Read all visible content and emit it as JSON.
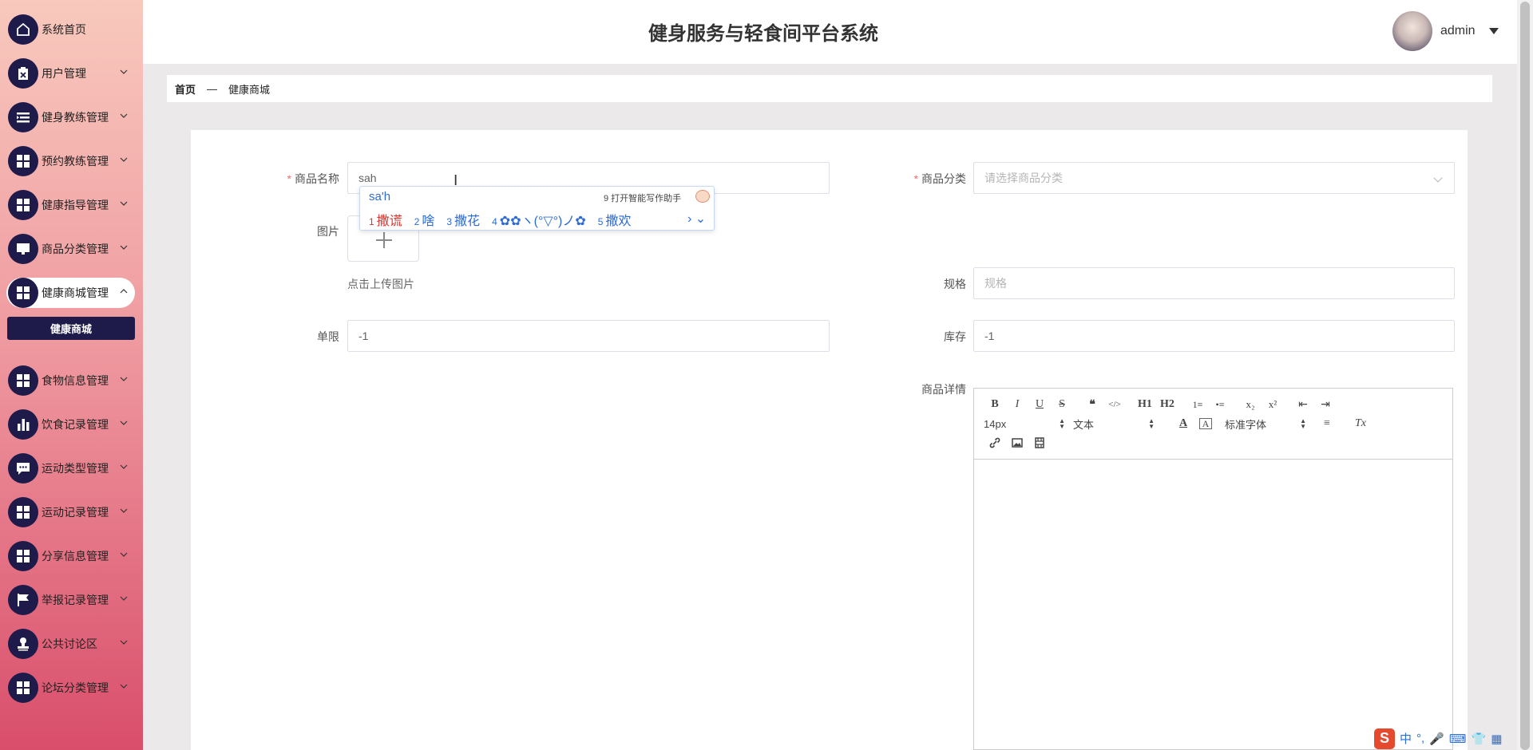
{
  "app": {
    "title": "健身服务与轻食间平台系统"
  },
  "user": {
    "name": "admin"
  },
  "sidebar": {
    "items": [
      {
        "label": "系统首页",
        "icon": "home-icon",
        "has_chevron": false
      },
      {
        "label": "用户管理",
        "icon": "clipboard-icon",
        "has_chevron": true
      },
      {
        "label": "健身教练管理",
        "icon": "list-icon",
        "has_chevron": true
      },
      {
        "label": "预约教练管理",
        "icon": "grid-icon",
        "has_chevron": true
      },
      {
        "label": "健康指导管理",
        "icon": "grid-icon",
        "has_chevron": true
      },
      {
        "label": "商品分类管理",
        "icon": "monitor-icon",
        "has_chevron": true
      },
      {
        "label": "健康商城管理",
        "icon": "grid-icon",
        "has_chevron": true,
        "expanded": true
      },
      {
        "label": "食物信息管理",
        "icon": "grid-icon",
        "has_chevron": true
      },
      {
        "label": "饮食记录管理",
        "icon": "bar-chart-icon",
        "has_chevron": true
      },
      {
        "label": "运动类型管理",
        "icon": "chat-icon",
        "has_chevron": true
      },
      {
        "label": "运动记录管理",
        "icon": "grid-icon",
        "has_chevron": true
      },
      {
        "label": "分享信息管理",
        "icon": "grid-icon",
        "has_chevron": true
      },
      {
        "label": "举报记录管理",
        "icon": "flag-icon",
        "has_chevron": true
      },
      {
        "label": "公共讨论区",
        "icon": "stamp-icon",
        "has_chevron": true
      },
      {
        "label": "论坛分类管理",
        "icon": "grid-icon",
        "has_chevron": true
      }
    ],
    "submenu": {
      "label": "健康商城"
    }
  },
  "breadcrumb": {
    "home": "首页",
    "separator": "—",
    "current": "健康商城"
  },
  "form": {
    "name": {
      "label": "商品名称",
      "value": "sah"
    },
    "category": {
      "label": "商品分类",
      "placeholder": "请选择商品分类"
    },
    "image": {
      "label": "图片",
      "hint": "点击上传图片"
    },
    "spec": {
      "label": "规格",
      "placeholder": "规格"
    },
    "limit": {
      "label": "单限",
      "value": "-1"
    },
    "stock": {
      "label": "库存",
      "value": "-1"
    },
    "detail": {
      "label": "商品详情"
    }
  },
  "ime": {
    "composition": "sa'h",
    "assistant_hint": "9 打开智能写作助手",
    "candidates": [
      {
        "num": "1",
        "text": "撒谎"
      },
      {
        "num": "2",
        "text": "啥"
      },
      {
        "num": "3",
        "text": "撒花"
      },
      {
        "num": "4",
        "text": "✿✿ヽ(°▽°)ノ✿"
      },
      {
        "num": "5",
        "text": "撒欢"
      }
    ],
    "nav": "› ⌄"
  },
  "editor": {
    "font_size": "14px",
    "header": "文本",
    "font_family": "标准字体",
    "buttons_row1": [
      "B",
      "I",
      "U",
      "S",
      "❝",
      "</>",
      "H1",
      "H2",
      "1≡",
      "•≡",
      "x₂",
      "x²",
      "⇤",
      "⇥"
    ],
    "buttons_row2": [
      "A",
      "A",
      "≡",
      "Tx"
    ]
  },
  "tray": {
    "lang": "中",
    "items": [
      "°,",
      "🎤",
      "⌨",
      "👕",
      "▦"
    ]
  }
}
